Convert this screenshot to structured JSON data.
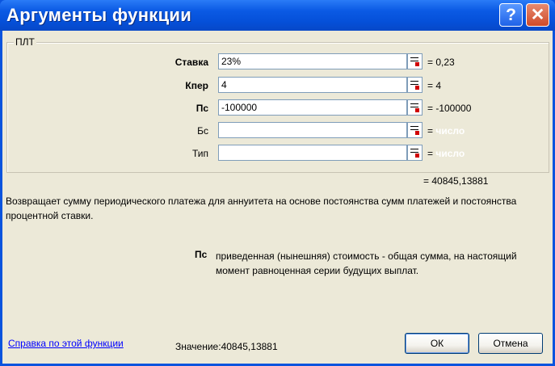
{
  "window": {
    "title": "Аргументы функции",
    "help_button": "?",
    "close_button": "✕"
  },
  "function_name": "ПЛТ",
  "arguments": [
    {
      "label": "Ставка",
      "value": "23%",
      "result": "= 0,23",
      "result_hint": ""
    },
    {
      "label": "Кпер",
      "value": "4",
      "result": "= 4",
      "result_hint": ""
    },
    {
      "label": "Пс",
      "value": "-100000",
      "result": "= -100000",
      "result_hint": ""
    },
    {
      "label": "Бс",
      "value": "",
      "result": "=",
      "result_hint": "число"
    },
    {
      "label": "Тип",
      "value": "",
      "result": "=",
      "result_hint": "число"
    }
  ],
  "total_result": "= 40845,13881",
  "description": "Возвращает сумму периодического платежа для аннуитета на основе постоянства сумм платежей и постоянства процентной ставки.",
  "current_param": {
    "name": "Пс",
    "description": "приведенная (нынешняя) стоимость - общая сумма, на настоящий момент равноценная серии будущих выплат."
  },
  "footer": {
    "help_link": "Справка по этой функции",
    "value_label": "Значение:",
    "value": "40845,13881",
    "ok_label": "ОК",
    "cancel_label": "Отмена"
  }
}
